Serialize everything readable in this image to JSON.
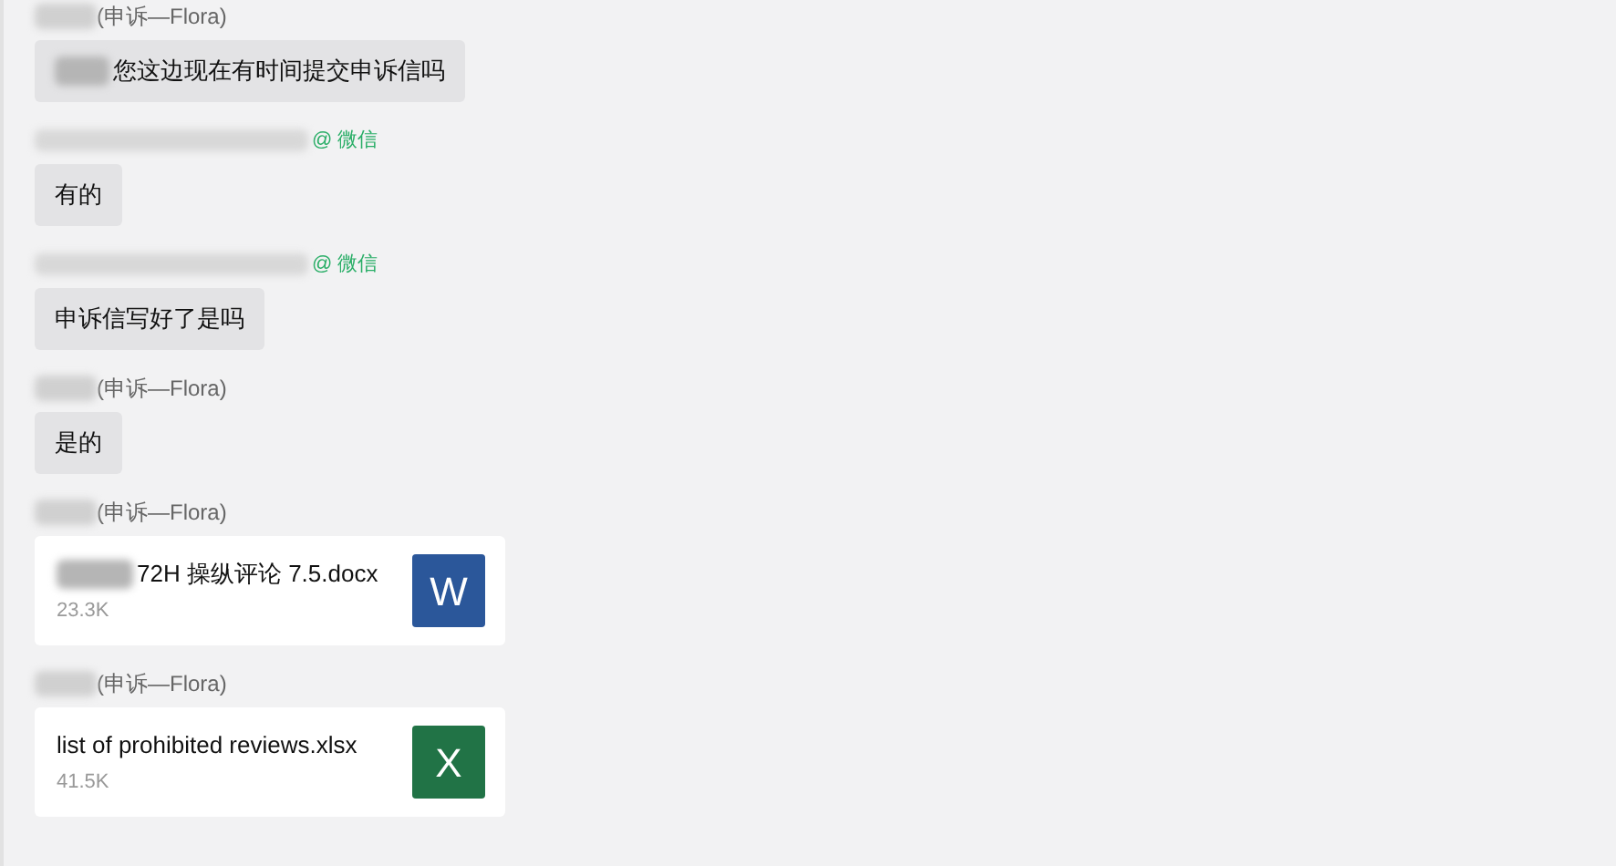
{
  "messages": [
    {
      "sender": {
        "kind": "agent",
        "label": "(申诉—Flora)"
      },
      "kind": "text",
      "redacted_prefix": true,
      "text": "您这边现在有时间提交申诉信吗"
    },
    {
      "sender": {
        "kind": "wechat",
        "label": "@ 微信"
      },
      "kind": "text",
      "redacted_prefix": false,
      "text": "有的"
    },
    {
      "sender": {
        "kind": "wechat",
        "label": "@ 微信"
      },
      "kind": "text",
      "redacted_prefix": false,
      "text": "申诉信写好了是吗"
    },
    {
      "sender": {
        "kind": "agent",
        "label": "(申诉—Flora)"
      },
      "kind": "text",
      "redacted_prefix": false,
      "text": "是的"
    },
    {
      "sender": {
        "kind": "agent",
        "label": "(申诉—Flora)"
      },
      "kind": "file",
      "redacted_prefix": true,
      "text": "72H 操纵评论 7.5.docx",
      "size": "23.3K",
      "icon_letter": "W",
      "color": "#2b579a"
    },
    {
      "sender": {
        "kind": "agent",
        "label": "(申诉—Flora)"
      },
      "kind": "file",
      "redacted_prefix": false,
      "text": "list of prohibited reviews.xlsx",
      "size": "41.5K",
      "icon_letter": "X",
      "color": "#217346"
    }
  ]
}
